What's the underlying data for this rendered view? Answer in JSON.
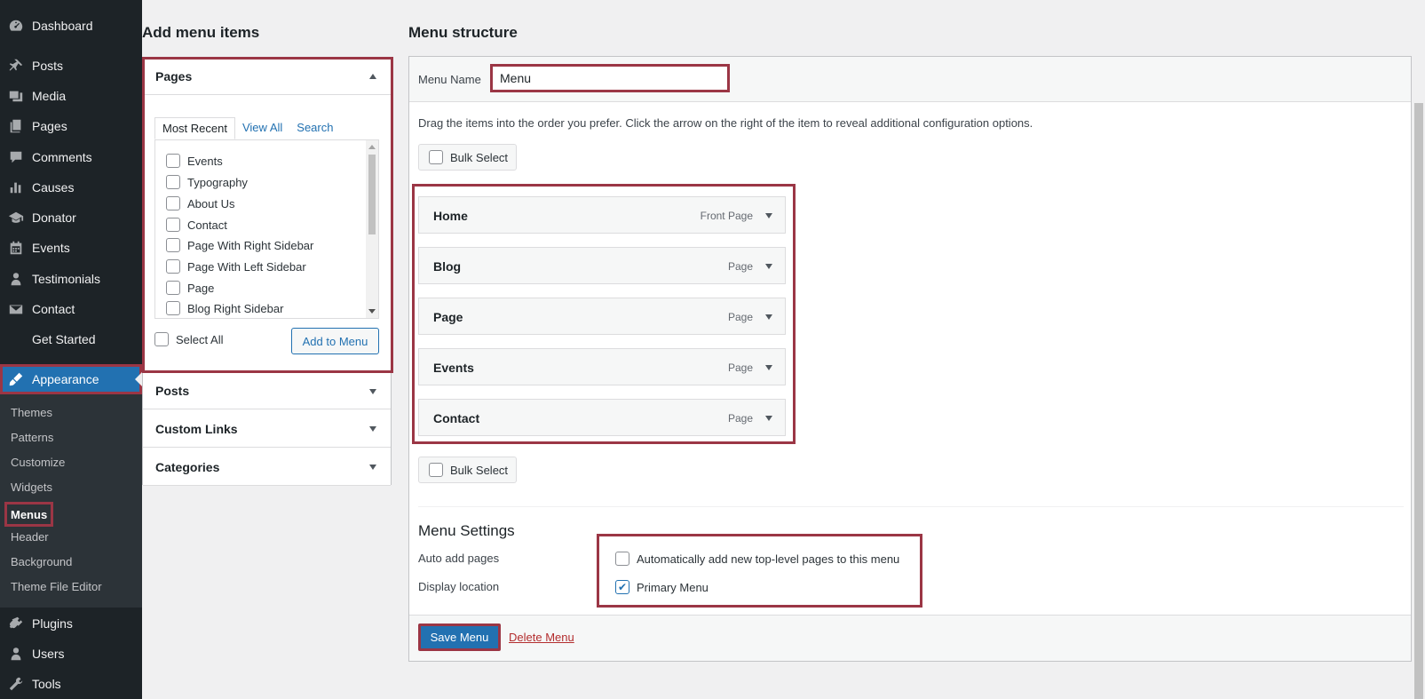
{
  "sidebar": {
    "items": [
      {
        "label": "Dashboard",
        "icon": "dashboard-icon"
      },
      {
        "label": "Posts",
        "icon": "pin-icon"
      },
      {
        "label": "Media",
        "icon": "media-icon"
      },
      {
        "label": "Pages",
        "icon": "pages-icon"
      },
      {
        "label": "Comments",
        "icon": "comment-icon"
      },
      {
        "label": "Causes",
        "icon": "bar-chart-icon"
      },
      {
        "label": "Donator",
        "icon": "graduation-cap-icon"
      },
      {
        "label": "Events",
        "icon": "calendar-icon"
      },
      {
        "label": "Testimonials",
        "icon": "person-icon"
      },
      {
        "label": "Contact",
        "icon": "envelope-icon"
      },
      {
        "label": "Get Started",
        "icon": ""
      },
      {
        "label": "Appearance",
        "icon": "paintbrush-icon"
      },
      {
        "label": "Plugins",
        "icon": "plugin-icon"
      },
      {
        "label": "Users",
        "icon": "user-icon"
      },
      {
        "label": "Tools",
        "icon": "wrench-icon"
      }
    ],
    "submenu": [
      "Themes",
      "Patterns",
      "Customize",
      "Widgets",
      "Menus",
      "Header",
      "Background",
      "Theme File Editor"
    ]
  },
  "add_items": {
    "title": "Add menu items",
    "sections": [
      "Pages",
      "Posts",
      "Custom Links",
      "Categories"
    ],
    "tabs": [
      "Most Recent",
      "View All",
      "Search"
    ],
    "pages": [
      "Events",
      "Typography",
      "About Us",
      "Contact",
      "Page With Right Sidebar",
      "Page With Left Sidebar",
      "Page",
      "Blog Right Sidebar"
    ],
    "select_all": "Select All",
    "add_button": "Add to Menu"
  },
  "structure": {
    "title": "Menu structure",
    "menu_name_label": "Menu Name",
    "menu_name_value": "Menu",
    "instructions": "Drag the items into the order you prefer. Click the arrow on the right of the item to reveal additional configuration options.",
    "bulk_select": "Bulk Select",
    "items": [
      {
        "title": "Home",
        "type": "Front Page"
      },
      {
        "title": "Blog",
        "type": "Page"
      },
      {
        "title": "Page",
        "type": "Page"
      },
      {
        "title": "Events",
        "type": "Page"
      },
      {
        "title": "Contact",
        "type": "Page"
      }
    ],
    "settings_title": "Menu Settings",
    "auto_add_label": "Auto add pages",
    "auto_add_option": "Automatically add new top-level pages to this menu",
    "display_location_label": "Display location",
    "primary_menu_option": "Primary Menu",
    "save_button": "Save Menu",
    "delete_link": "Delete Menu"
  },
  "colors": {
    "sidebar_bg": "#1d2327",
    "accent": "#2271b1",
    "highlight": "#9b3645"
  }
}
